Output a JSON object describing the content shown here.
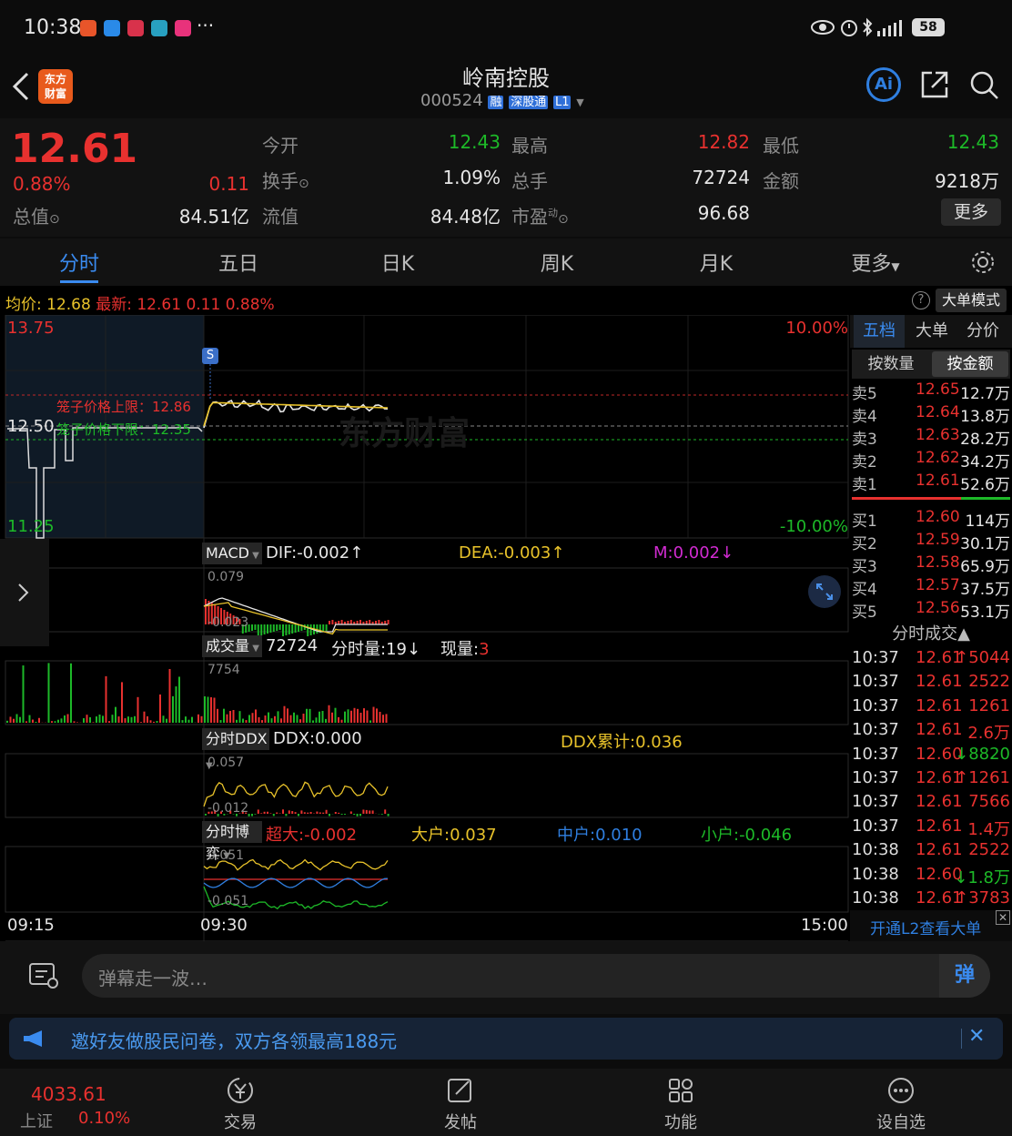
{
  "status": {
    "time": "10:38",
    "battery": "58",
    "dots": "···"
  },
  "header": {
    "title": "岭南控股",
    "code": "000524",
    "tag_rong": "融",
    "tag_sgt": "深股通",
    "tag_l1": "L1",
    "logo": "东方\n财富",
    "ai": "Ai"
  },
  "quote": {
    "price": "12.61",
    "pct": "0.88%",
    "chg": "0.11",
    "open_label": "今开",
    "open": "12.43",
    "high_label": "最高",
    "high": "12.82",
    "low_label": "最低",
    "low": "12.43",
    "turnover_label": "换手",
    "turnover": "1.09%",
    "vol_label": "总手",
    "vol": "72724",
    "amt_label": "金额",
    "amt": "9218万",
    "mcap_label": "总值",
    "mcap": "84.51亿",
    "float_label": "流值",
    "float": "84.48亿",
    "pe_label": "市盈",
    "pe_sup": "动",
    "pe": "96.68",
    "more": "更多"
  },
  "tabs": [
    "分时",
    "五日",
    "日K",
    "周K",
    "月K",
    "更多"
  ],
  "infobar": {
    "avg_label": "均价:",
    "avg": "12.68",
    "last_label": "最新:",
    "last": "12.61",
    "chg": "0.11",
    "pct": "0.88%",
    "bigorder": "大单模式"
  },
  "main_chart": {
    "y_top": "13.75",
    "y_mid": "12.50",
    "y_bot": "11.25",
    "pct_top": "10.00%",
    "pct_bot": "-10.00%",
    "upper_limit": "笼子价格上限：12.86",
    "lower_limit": "笼子价格下限：12.35",
    "marker": "S",
    "watermark": "东方财富"
  },
  "macd": {
    "name": "MACD",
    "dif": "DIF:-0.002↑",
    "dea": "DEA:-0.003↑",
    "m": "M:0.002↓",
    "top": "0.079",
    "bot": "-0.023"
  },
  "volume": {
    "name": "成交量",
    "total": "72724",
    "fs_label": "分时量:19↓",
    "xl_label": "现量:",
    "xl": "3",
    "top": "7754"
  },
  "ddx": {
    "name": "分时DDX",
    "ddx": "DDX:0.000",
    "cum": "DDX累计:0.036",
    "top": "0.057",
    "bot": "-0.012"
  },
  "game": {
    "name": "分时博弈",
    "super": "超大:-0.002",
    "big": "大户:0.037",
    "mid": "中户:0.010",
    "small": "小户:-0.046",
    "top": "0.051",
    "bot": "-0.051"
  },
  "time_axis": [
    "09:15",
    "09:30",
    "15:00"
  ],
  "side_tabs": [
    "五档",
    "大单",
    "分价"
  ],
  "side_sub": [
    "按数量",
    "按金额"
  ],
  "asks": [
    {
      "l": "卖5",
      "p": "12.65",
      "v": "12.7万"
    },
    {
      "l": "卖4",
      "p": "12.64",
      "v": "13.8万"
    },
    {
      "l": "卖3",
      "p": "12.63",
      "v": "28.2万"
    },
    {
      "l": "卖2",
      "p": "12.62",
      "v": "34.2万"
    },
    {
      "l": "卖1",
      "p": "12.61",
      "v": "52.6万"
    }
  ],
  "bids": [
    {
      "l": "买1",
      "p": "12.60",
      "v": "114万"
    },
    {
      "l": "买2",
      "p": "12.59",
      "v": "30.1万"
    },
    {
      "l": "买3",
      "p": "12.58",
      "v": "65.9万"
    },
    {
      "l": "买4",
      "p": "12.57",
      "v": "37.5万"
    },
    {
      "l": "买5",
      "p": "12.56",
      "v": "53.1万"
    }
  ],
  "ticks_title": "分时成交▲",
  "ticks": [
    {
      "t": "10:37",
      "p": "12.61",
      "v": "↑5044",
      "c": "red"
    },
    {
      "t": "10:37",
      "p": "12.61",
      "v": "2522",
      "c": "red"
    },
    {
      "t": "10:37",
      "p": "12.61",
      "v": "1261",
      "c": "red"
    },
    {
      "t": "10:37",
      "p": "12.61",
      "v": "2.6万",
      "c": "red"
    },
    {
      "t": "10:37",
      "p": "12.60",
      "v": "↓8820",
      "c": "green"
    },
    {
      "t": "10:37",
      "p": "12.61",
      "v": "↑1261",
      "c": "red"
    },
    {
      "t": "10:37",
      "p": "12.61",
      "v": "7566",
      "c": "red"
    },
    {
      "t": "10:37",
      "p": "12.61",
      "v": "1.4万",
      "c": "red"
    },
    {
      "t": "10:38",
      "p": "12.61",
      "v": "2522",
      "c": "red"
    },
    {
      "t": "10:38",
      "p": "12.60",
      "v": "↓1.8万",
      "c": "green"
    },
    {
      "t": "10:38",
      "p": "12.61",
      "v": "↑3783",
      "c": "red"
    }
  ],
  "l2_link": "开通L2查看大单",
  "comment": {
    "placeholder": "弹幕走一波…",
    "danmu": "弹"
  },
  "banner": "邀好友做股民问卷，双方各领最高188元",
  "index": {
    "value": "4033.61",
    "name": "上证",
    "pct": "0.10%"
  },
  "nav": [
    "交易",
    "发帖",
    "功能",
    "设自选"
  ]
}
